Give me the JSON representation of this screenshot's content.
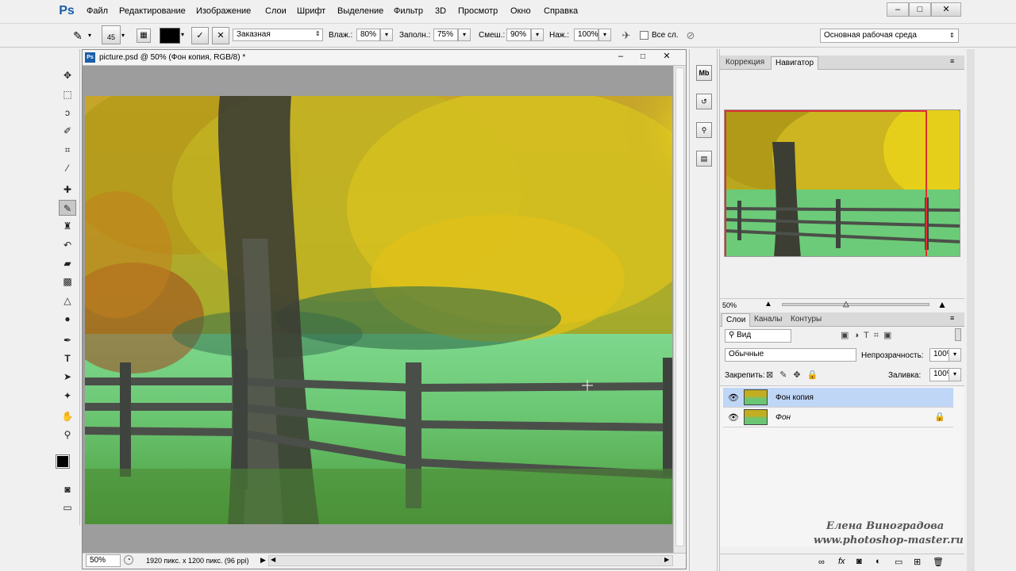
{
  "app": {
    "logo": "Ps",
    "menu": [
      "Файл",
      "Редактирование",
      "Изображение",
      "Слои",
      "Шрифт",
      "Выделение",
      "Фильтр",
      "3D",
      "Просмотр",
      "Окно",
      "Справка"
    ],
    "window_buttons": [
      "–",
      "□",
      "✕"
    ]
  },
  "options": {
    "brush_size": "45",
    "mode_value": "Заказная",
    "wet_label": "Влаж.:",
    "wet_value": "80%",
    "load_label": "Заполн.:",
    "load_value": "75%",
    "mix_label": "Смеш.:",
    "mix_value": "90%",
    "flow_label": "Наж.:",
    "flow_value": "100%",
    "sample_all_label": "Все сл.",
    "workspace_value": "Основная рабочая среда"
  },
  "document": {
    "title": "picture.psd @ 50% (Фон копия, RGB/8) *",
    "zoom": "50%",
    "info": "1920 пикс. x 1200 пикс. (96 ppi)",
    "doc_icon": "Ps"
  },
  "navigator": {
    "tabs": [
      "Коррекция",
      "Навигатор"
    ],
    "active_tab": "Навигатор",
    "zoom": "50%"
  },
  "layers": {
    "tabs": [
      "Слои",
      "Каналы",
      "Контуры"
    ],
    "filter_value": "Вид",
    "blend_mode": "Обычные",
    "opacity_label": "Непрозрачность:",
    "opacity_value": "100%",
    "lock_label": "Закрепить:",
    "fill_label": "Заливка:",
    "fill_value": "100%",
    "items": [
      {
        "name": "Фон копия",
        "selected": true,
        "locked": false
      },
      {
        "name": "Фон",
        "selected": false,
        "locked": true
      }
    ],
    "bottom_icons": [
      "link-icon",
      "fx-icon",
      "mask-icon",
      "adjustment-icon",
      "folder-icon",
      "new-layer-icon",
      "trash-icon"
    ],
    "fx_label": "fx"
  },
  "strip_icons": [
    "Mb",
    "history-icon",
    "tool-presets-icon",
    "layer-comps-icon"
  ],
  "strip_labels": [
    "Mb",
    "↺",
    "⚲",
    "▤"
  ],
  "watermark": {
    "line1": "Елена Виноградова",
    "line2": "www.photoshop-master.ru"
  },
  "colors": {
    "accent_logo": "#1a5da9",
    "selected_layer": "#bfd6f6"
  }
}
